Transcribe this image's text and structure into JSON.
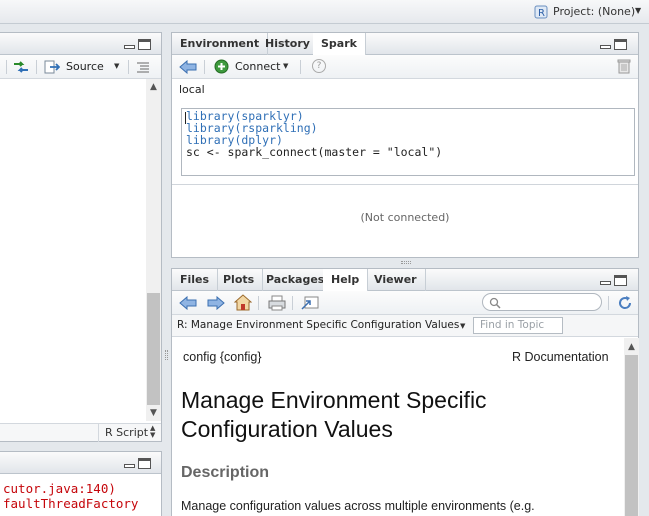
{
  "topbar": {
    "project_label": "Project: (None)"
  },
  "source_pane": {
    "source_button_label": "Source",
    "file_type_label": "R Script",
    "console_lines": [
      "cutor.java:140)",
      "faultThreadFactory"
    ]
  },
  "env_pane": {
    "tabs": [
      "Environment",
      "History",
      "Spark"
    ],
    "active_tab": "Spark",
    "connect_label": "Connect",
    "connection_name": "local",
    "code_lines": [
      "library(sparklyr)",
      "library(rsparkling)",
      "library(dplyr)",
      "sc <- spark_connect(master = \"local\")"
    ],
    "status_text": "(Not connected)"
  },
  "help_pane": {
    "tabs": [
      "Files",
      "Plots",
      "Packages",
      "Help",
      "Viewer"
    ],
    "active_tab": "Help",
    "topic_title": "R: Manage Environment Specific Configuration Values",
    "find_placeholder": "Find in Topic",
    "doc_package": "config {config}",
    "doc_kind": "R Documentation",
    "heading_line1": "Manage Environment Specific",
    "heading_line2": "Configuration Values",
    "section_title": "Description",
    "description_text": "Manage configuration values across multiple environments (e.g."
  },
  "colors": {
    "accent": "#2f6fb6",
    "error_text": "#c5060b",
    "link_blue": "#1d58a8"
  }
}
